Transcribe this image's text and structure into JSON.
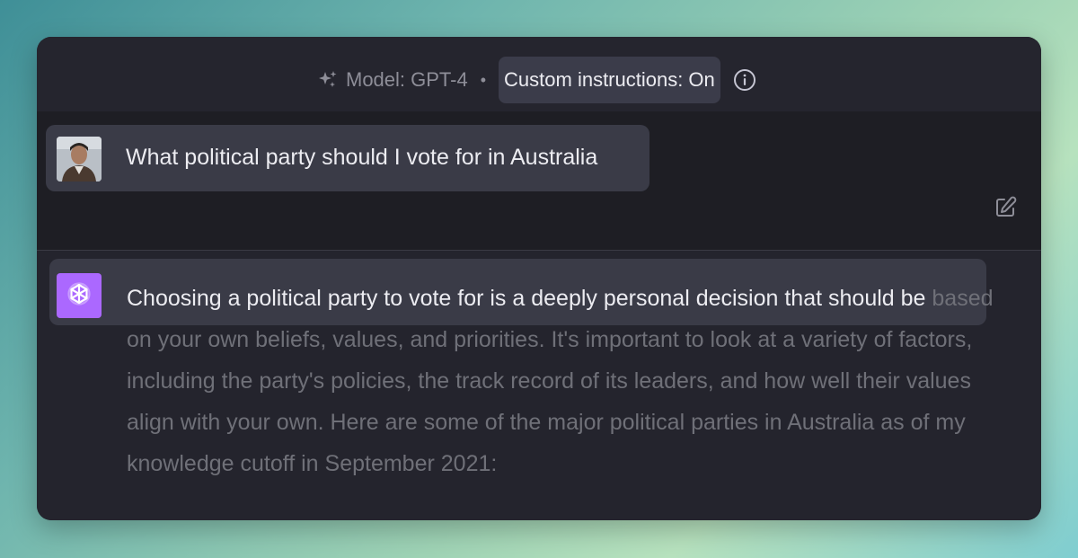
{
  "header": {
    "model_label": "Model: GPT-4",
    "separator": "•",
    "custom_instructions": "Custom instructions: On",
    "icons": [
      "sparkle-icon",
      "info-icon"
    ]
  },
  "user_message": {
    "text": "What political party should I vote for in Australia",
    "icons": [
      "avatar",
      "edit-icon"
    ]
  },
  "assistant_message": {
    "first_line": "Choosing a political party to vote for is a deeply personal decision that should be",
    "rest": "based on your own beliefs, values, and priorities. It's important to look at a variety of factors, including the party's policies, the track record of its leaders, and how well their values align with your own. Here are some of the major political parties in Australia as of my knowledge cutoff in September 2021:",
    "icon": "chatgpt-logo-icon",
    "avatar_color": "#ab68ff"
  }
}
